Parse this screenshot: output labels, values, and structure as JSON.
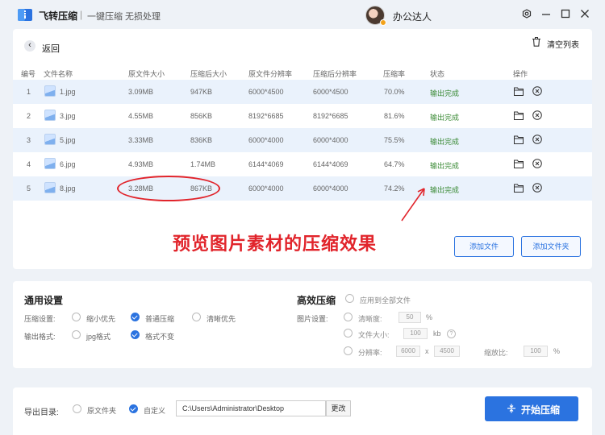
{
  "app": {
    "name": "飞转压缩",
    "separator": "|",
    "tagline": "一键压缩 无损处理",
    "username": "办公达人"
  },
  "toolbar": {
    "back_label": "返回",
    "clear_label": "清空列表"
  },
  "table": {
    "headers": [
      "编号",
      "文件名称",
      "原文件大小",
      "压缩后大小",
      "原文件分辨率",
      "压缩后分辨率",
      "压缩率",
      "状态",
      "操作"
    ],
    "rows": [
      {
        "no": "1",
        "name": "1.jpg",
        "orig_size": "3.09MB",
        "comp_size": "947KB",
        "orig_res": "6000*4500",
        "comp_res": "6000*4500",
        "ratio": "70.0%",
        "status": "输出完成"
      },
      {
        "no": "2",
        "name": "3.jpg",
        "orig_size": "4.55MB",
        "comp_size": "856KB",
        "orig_res": "8192*6685",
        "comp_res": "8192*6685",
        "ratio": "81.6%",
        "status": "输出完成"
      },
      {
        "no": "3",
        "name": "5.jpg",
        "orig_size": "3.33MB",
        "comp_size": "836KB",
        "orig_res": "6000*4000",
        "comp_res": "6000*4000",
        "ratio": "75.5%",
        "status": "输出完成"
      },
      {
        "no": "4",
        "name": "6.jpg",
        "orig_size": "4.93MB",
        "comp_size": "1.74MB",
        "orig_res": "6144*4069",
        "comp_res": "6144*4069",
        "ratio": "64.7%",
        "status": "输出完成"
      },
      {
        "no": "5",
        "name": "8.jpg",
        "orig_size": "3.28MB",
        "comp_size": "867KB",
        "orig_res": "6000*4000",
        "comp_res": "6000*4000",
        "ratio": "74.2%",
        "status": "输出完成"
      }
    ]
  },
  "annotation": {
    "text": "预览图片素材的压缩效果",
    "color": "#e1242b"
  },
  "buttons": {
    "add_file": "添加文件",
    "add_folder": "添加文件夹",
    "start": "开始压缩",
    "change": "更改"
  },
  "general": {
    "title": "通用设置",
    "compress_label": "压缩设置:",
    "compress_options": [
      "缩小优先",
      "普通压缩",
      "清晰优先"
    ],
    "compress_selected": "普通压缩",
    "format_label": "输出格式:",
    "format_options": [
      "jpg格式",
      "格式不变"
    ],
    "format_selected": "格式不变"
  },
  "advanced": {
    "title": "高效压缩",
    "apply_all": "应用到全部文件",
    "image_label": "图片设置:",
    "clarity_label": "清晰度:",
    "clarity_value": "50",
    "clarity_unit": "%",
    "filesize_label": "文件大小:",
    "filesize_value": "100",
    "filesize_unit": "kb",
    "help": "?",
    "resolution_label": "分辨率:",
    "res_width": "6000",
    "res_x": "x",
    "res_height": "4500",
    "scale_label": "缩放比:",
    "scale_value": "100",
    "scale_unit": "%"
  },
  "export": {
    "label": "导出目录:",
    "options": [
      "原文件夹",
      "自定义"
    ],
    "selected": "自定义",
    "path": "C:\\Users\\Administrator\\Desktop"
  },
  "colors": {
    "accent": "#2b73e0",
    "status_green": "#3a8a35",
    "row_highlight": "#eaf2fc",
    "background": "#eef2f7"
  }
}
